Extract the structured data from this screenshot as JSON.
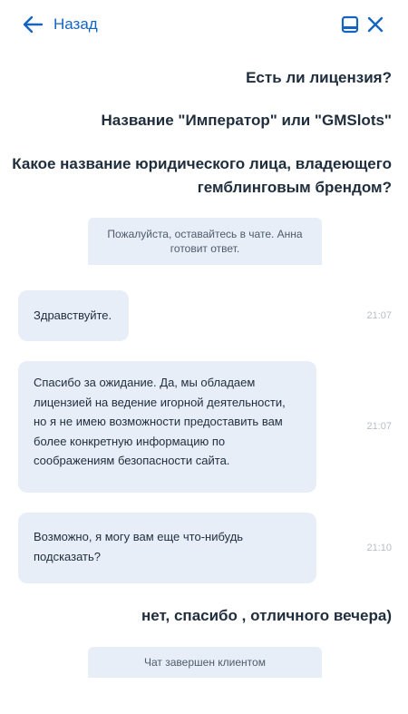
{
  "header": {
    "back_label": "Назад"
  },
  "messages": {
    "client_1": "Есть ли лицензия?",
    "client_2": "Название \"Император\" или \"GMSlots\"",
    "client_3_line1": "Какое название юридического лица, владеющего",
    "client_3_line2": "гемблинговым брендом?",
    "system_1_line1": "Пожалуйста, оставайтесь в чате. Анна",
    "system_1_line2": "готовит ответ.",
    "agent_1": {
      "text": "Здравствуйте.",
      "time": "21:07"
    },
    "agent_2": {
      "lines": [
        "Спасибо за ожидание. Да, мы обладаем",
        "лицензией на ведение игорной деятельности,",
        "но я не имею возможности предоставить вам",
        "более конкретную информацию по",
        "соображениям безопасности сайта."
      ],
      "time": "21:07"
    },
    "agent_3": {
      "lines": [
        "Возможно, я могу вам еще что-нибудь",
        "подсказать?"
      ],
      "time": "21:10"
    },
    "client_4": "нет, спасибо , отличного вечера)",
    "system_2": "Чат завершен клиентом"
  },
  "colors": {
    "accent": "#1565c0",
    "bubble": "#e8eef7",
    "text": "#1f2d3d",
    "time": "#b6bfc9"
  },
  "icons": {
    "back": "arrow-left-icon",
    "minimize": "minimize-window-icon",
    "close": "close-icon"
  }
}
